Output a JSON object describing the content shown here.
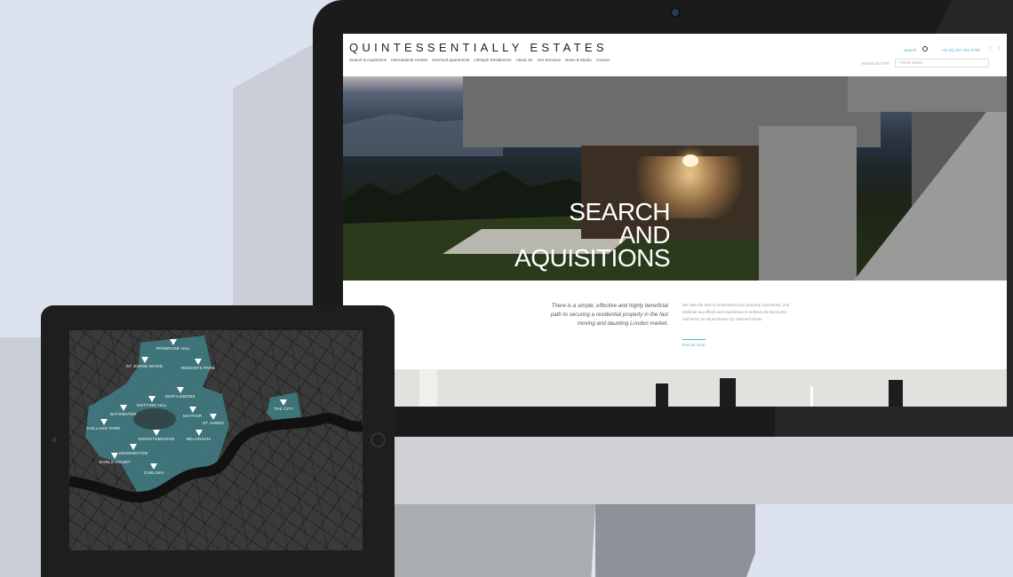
{
  "site": {
    "logo": "QUINTESSENTIALLY ESTATES",
    "nav": [
      "Search & Aquisitions",
      "International Homes",
      "Serviced apartments",
      "Lifestyle Residences",
      "About Us",
      "Our Services",
      "News & Media",
      "Contact"
    ],
    "search_label": "Search",
    "phone": "+44 (0) 207 201 0700",
    "newsletter_label": "NEWSLETTER",
    "email_placeholder": "YOUR EMAIL",
    "hero_title_lines": [
      "SEARCH",
      "AND",
      "AQUISITIONS"
    ],
    "intro_left": "There is a simple, effective and highly beneficial path to securing a residential property in the fast moving and daunting London market.",
    "intro_right": "We take the time to understand your property aspirations, and dedicate our efforts and experience to achieve the best price and terms on all purchases by retained clients.",
    "intro_link": "find out more"
  },
  "icons": {
    "search": "search-icon",
    "facebook": "facebook-icon",
    "twitter": "twitter-icon"
  },
  "colors": {
    "accent": "#4fb3c3",
    "map_highlight": "#3f7f86",
    "map_bg": "#3a3a3a",
    "river": "#111111"
  },
  "map": {
    "areas": [
      "PRIMROSE HILL",
      "ST JOHNS WOOD",
      "REGENTS PARK",
      "MARYLEBONE",
      "NOTTING HILL",
      "BAYSWATER",
      "MAYFAIR",
      "ST JAMES",
      "HOLLAND PARK",
      "KNIGHTSBRIDGE",
      "BELGRAVIA",
      "KENSINGTON",
      "EARLS COURT",
      "CHELSEA",
      "THE CITY"
    ]
  }
}
